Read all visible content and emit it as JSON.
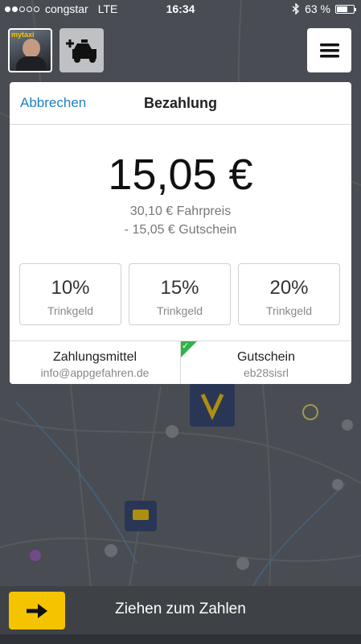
{
  "status_bar": {
    "carrier": "congstar",
    "network": "LTE",
    "time": "16:34",
    "battery": "63 %",
    "battery_level": 0.63
  },
  "top_controls": {
    "avatar_badge": "mytaxi"
  },
  "payment": {
    "cancel_label": "Abbrechen",
    "title": "Bezahlung",
    "total": "15,05 €",
    "fare_line": "30,10 € Fahrpreis",
    "voucher_line": "- 15,05 € Gutschein",
    "tips": [
      {
        "percent": "10%",
        "label": "Trinkgeld"
      },
      {
        "percent": "15%",
        "label": "Trinkgeld"
      },
      {
        "percent": "20%",
        "label": "Trinkgeld"
      }
    ],
    "payment_method": {
      "title": "Zahlungsmittel",
      "value": "info@appgefahren.de"
    },
    "voucher": {
      "title": "Gutschein",
      "value": "eb28sisrl",
      "selected": true
    }
  },
  "bottom_bar": {
    "slide_label": "Ziehen zum Zahlen"
  },
  "colors": {
    "accent_blue": "#1f7fc2",
    "brand_yellow": "#f5c400",
    "check_green": "#2fb34a"
  }
}
